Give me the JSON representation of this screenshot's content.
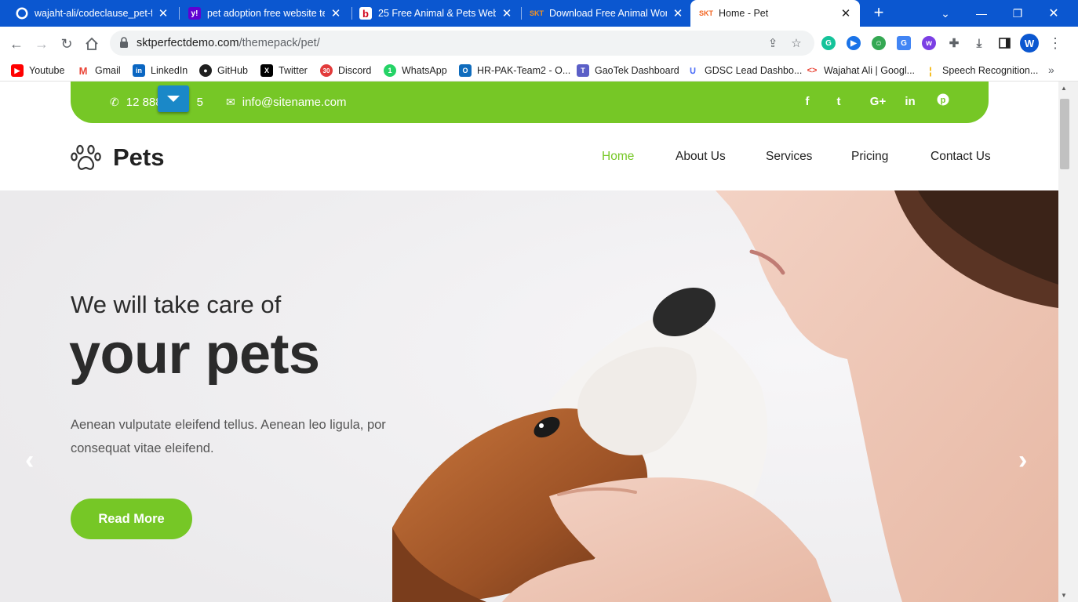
{
  "browser": {
    "tabs": [
      {
        "title": "wajaht-ali/codeclause_pet-fin",
        "icon": "github-icon"
      },
      {
        "title": "pet adoption free website te",
        "icon": "yahoo-icon"
      },
      {
        "title": "25 Free Animal & Pets Websit",
        "icon": "bootstrap-b-icon"
      },
      {
        "title": "Download Free Animal Word",
        "icon": "skt-icon"
      },
      {
        "title": "Home - Pet",
        "icon": "skt-icon"
      }
    ],
    "url_domain": "sktperfectdemo.com",
    "url_path": "/themepack/pet/",
    "profile_initial": "W",
    "bookmarks": [
      {
        "label": "Youtube",
        "icon": "youtube-icon"
      },
      {
        "label": "Gmail",
        "icon": "gmail-icon"
      },
      {
        "label": "LinkedIn",
        "icon": "linkedin-icon"
      },
      {
        "label": "GitHub",
        "icon": "github-icon"
      },
      {
        "label": "Twitter",
        "icon": "x-icon"
      },
      {
        "label": "Discord",
        "icon": "discord-icon"
      },
      {
        "label": "WhatsApp",
        "icon": "whatsapp-icon"
      },
      {
        "label": "HR-PAK-Team2 - O...",
        "icon": "outlook-icon"
      },
      {
        "label": "GaoTek Dashboard",
        "icon": "teams-icon"
      },
      {
        "label": "GDSC Lead Dashbo...",
        "icon": "gdsc-icon"
      },
      {
        "label": "Wajahat Ali | Googl...",
        "icon": "code-icon"
      },
      {
        "label": "Speech Recognition...",
        "icon": "mic-icon"
      }
    ]
  },
  "site": {
    "phone": "12 888 ",
    "phone_end": "5",
    "email": "info@sitename.com",
    "social": [
      "f",
      "t",
      "G+",
      "in",
      "p"
    ],
    "brand": "Pets",
    "menu": [
      "Home",
      "About Us",
      "Services",
      "Pricing",
      "Contact Us"
    ],
    "hero": {
      "kicker": "We will take care of",
      "headline": "your pets",
      "description": "Aenean vulputate eleifend tellus. Aenean leo ligula, por consequat vitae eleifend.",
      "button": "Read More"
    }
  },
  "colors": {
    "brand_green": "#76c726",
    "chrome_blue": "#0b57d0",
    "toggle_blue": "#1a88c8"
  }
}
